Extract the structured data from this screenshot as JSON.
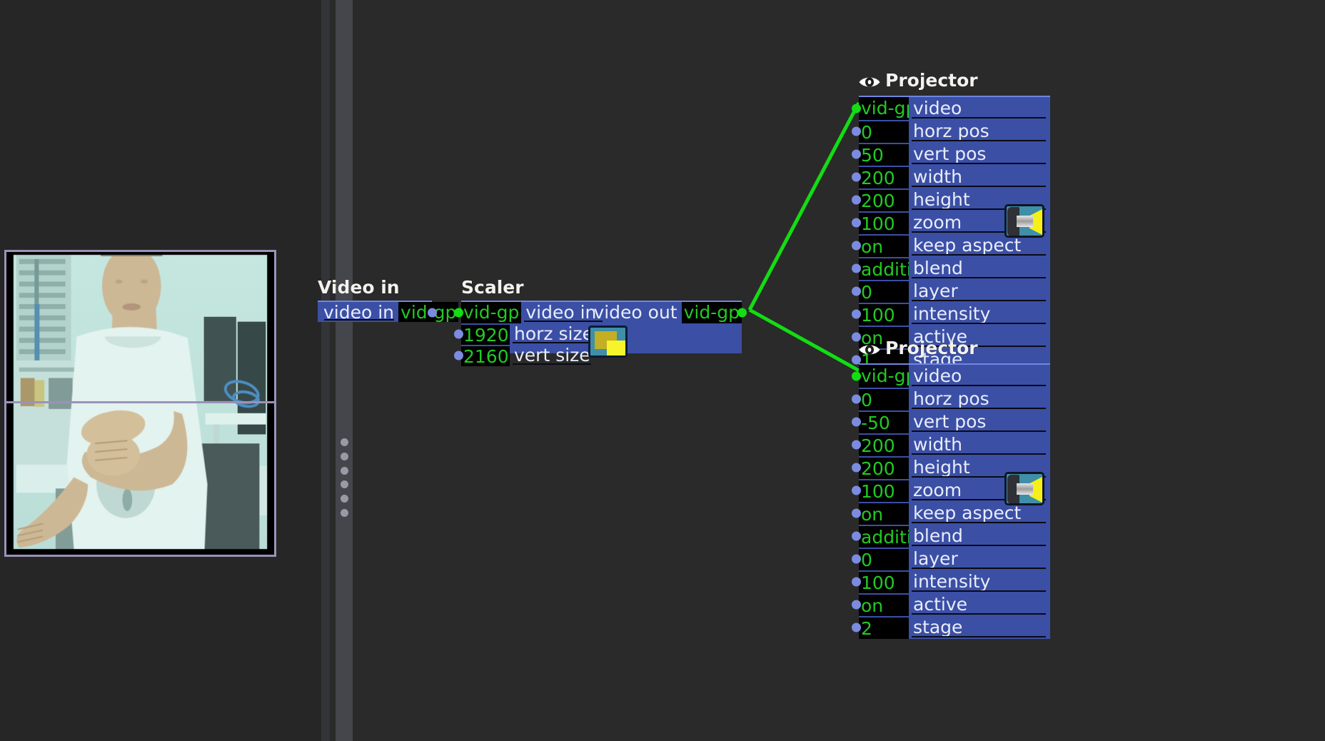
{
  "app": {
    "background_color": "#2a2a2a",
    "node_color": "#3b4fa5",
    "value_text_color": "#23c923",
    "link_color": "#13dd13"
  },
  "preview": {
    "name": "video-preview",
    "border_color": "#9b92b8"
  },
  "splitter": {
    "name": "panel-splitter",
    "dots": 6
  },
  "nodes": [
    {
      "title": "Video in",
      "icon": "",
      "rows": [
        {
          "label": "video in",
          "value": "vid-gp",
          "value_side": "right"
        }
      ]
    },
    {
      "title": "Scaler",
      "icon": "scaler-icon",
      "rows": [
        {
          "label": "video in",
          "value": "vid-gp"
        },
        {
          "label": "horz size",
          "value": "1920"
        },
        {
          "label": "vert size",
          "value": "2160"
        }
      ],
      "output": {
        "label": "video out",
        "value": "vid-gp"
      }
    },
    {
      "title": "Projector",
      "icon": "projector-icon",
      "rows": [
        {
          "label": "video",
          "value": "vid-gp"
        },
        {
          "label": "horz pos",
          "value": "0"
        },
        {
          "label": "vert pos",
          "value": "50"
        },
        {
          "label": "width",
          "value": "200"
        },
        {
          "label": "height",
          "value": "200"
        },
        {
          "label": "zoom",
          "value": "100"
        },
        {
          "label": "keep aspect",
          "value": "on"
        },
        {
          "label": "blend",
          "value": "additive"
        },
        {
          "label": "layer",
          "value": "0"
        },
        {
          "label": "intensity",
          "value": "100"
        },
        {
          "label": "active",
          "value": "on"
        },
        {
          "label": "stage",
          "value": "1"
        }
      ]
    },
    {
      "title": "Projector",
      "icon": "projector-icon",
      "rows": [
        {
          "label": "video",
          "value": "vid-gp"
        },
        {
          "label": "horz pos",
          "value": "0"
        },
        {
          "label": "vert pos",
          "value": "-50"
        },
        {
          "label": "width",
          "value": "200"
        },
        {
          "label": "height",
          "value": "200"
        },
        {
          "label": "zoom",
          "value": "100"
        },
        {
          "label": "keep aspect",
          "value": "on"
        },
        {
          "label": "blend",
          "value": "additive"
        },
        {
          "label": "layer",
          "value": "0"
        },
        {
          "label": "intensity",
          "value": "100"
        },
        {
          "label": "active",
          "value": "on"
        },
        {
          "label": "stage",
          "value": "2"
        }
      ]
    }
  ]
}
